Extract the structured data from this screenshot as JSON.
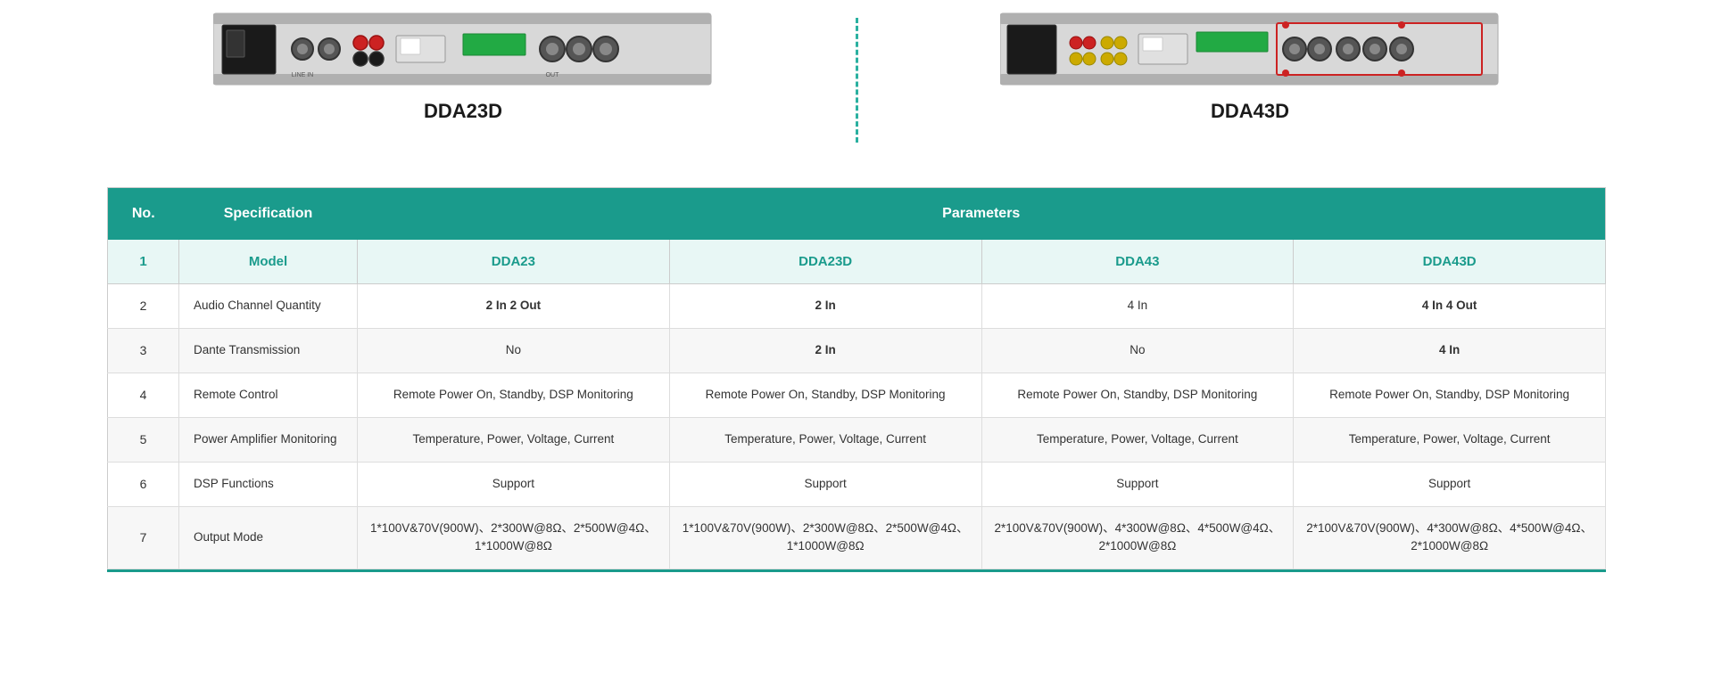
{
  "products": [
    {
      "id": "dda23d",
      "title": "DDA23D",
      "position": "left"
    },
    {
      "id": "dda43d",
      "title": "DDA43D",
      "position": "right"
    }
  ],
  "table": {
    "headers": {
      "no": "No.",
      "specification": "Specification",
      "parameters": "Parameters"
    },
    "subheaders": {
      "no": "1",
      "specification": "Model",
      "col1": "DDA23",
      "col2": "DDA23D",
      "col3": "DDA43",
      "col4": "DDA43D"
    },
    "rows": [
      {
        "no": "2",
        "spec": "Audio Channel Quantity",
        "col1": "2 In 2 Out",
        "col2": "2 In",
        "col3": "4 In",
        "col4": "4 In 4 Out",
        "bold": [
          true,
          true,
          false,
          true
        ],
        "alt": false
      },
      {
        "no": "3",
        "spec": "Dante Transmission",
        "col1": "No",
        "col2": "2 In",
        "col3": "No",
        "col4": "4 In",
        "bold": [
          false,
          true,
          false,
          true
        ],
        "alt": true
      },
      {
        "no": "4",
        "spec": "Remote Control",
        "col1": "Remote Power On, Standby, DSP Monitoring",
        "col2": "Remote Power On, Standby, DSP Monitoring",
        "col3": "Remote Power On, Standby, DSP Monitoring",
        "col4": "Remote Power On, Standby, DSP Monitoring",
        "bold": [
          false,
          false,
          false,
          false
        ],
        "alt": false
      },
      {
        "no": "5",
        "spec": "Power Amplifier Monitoring",
        "col1": "Temperature, Power, Voltage, Current",
        "col2": "Temperature, Power, Voltage, Current",
        "col3": "Temperature, Power, Voltage, Current",
        "col4": "Temperature, Power, Voltage, Current",
        "bold": [
          false,
          false,
          false,
          false
        ],
        "alt": true
      },
      {
        "no": "6",
        "spec": "DSP Functions",
        "col1": "Support",
        "col2": "Support",
        "col3": "Support",
        "col4": "Support",
        "bold": [
          false,
          false,
          false,
          false
        ],
        "alt": false
      },
      {
        "no": "7",
        "spec": "Output Mode",
        "col1": "1*100V&70V(900W)、2*300W@8Ω、2*500W@4Ω、1*1000W@8Ω",
        "col2": "1*100V&70V(900W)、2*300W@8Ω、2*500W@4Ω、1*1000W@8Ω",
        "col3": "2*100V&70V(900W)、4*300W@8Ω、4*500W@4Ω、2*1000W@8Ω",
        "col4": "2*100V&70V(900W)、4*300W@8Ω、4*500W@4Ω、2*1000W@8Ω",
        "bold": [
          false,
          false,
          false,
          false
        ],
        "alt": true
      }
    ]
  }
}
